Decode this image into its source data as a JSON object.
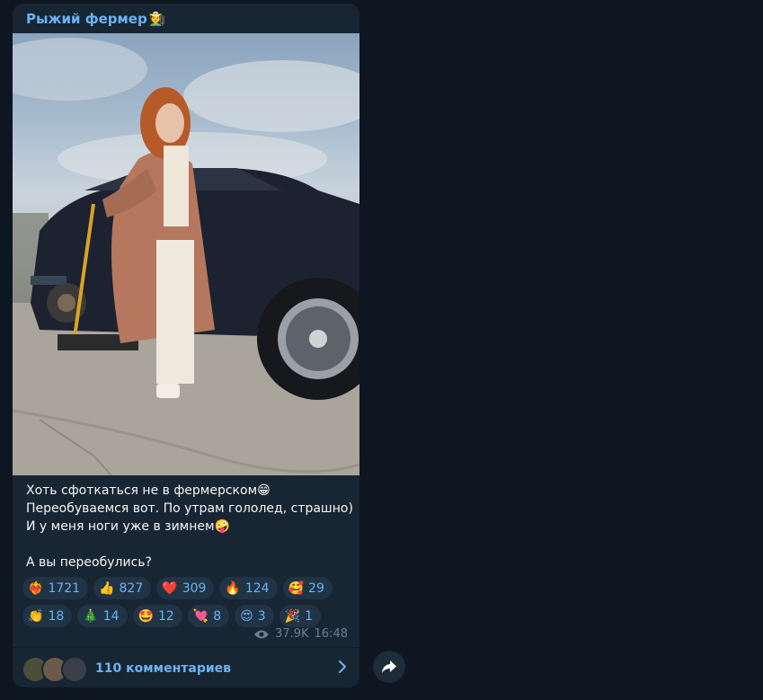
{
  "post": {
    "channel_name": "Рыжий фермер",
    "channel_emoji": "🧑‍🌾",
    "text_lines": [
      {
        "text": "Хоть сфоткаться не в фермерском",
        "emoji": "😁"
      },
      {
        "text": "Переобуваемся вот. По утрам гололед, страшно)",
        "emoji": ""
      },
      {
        "text": "И у меня ноги уже в зимнем",
        "emoji": "🤪"
      },
      {
        "text": "",
        "emoji": ""
      },
      {
        "text": "А вы переобулись?",
        "emoji": ""
      }
    ],
    "reactions_row1": [
      {
        "emoji": "❤️‍🔥",
        "count": "1721"
      },
      {
        "emoji": "👍",
        "count": "827"
      },
      {
        "emoji": "❤️",
        "count": "309"
      },
      {
        "emoji": "🔥",
        "count": "124"
      },
      {
        "emoji": "🥰",
        "count": "29"
      }
    ],
    "reactions_row2": [
      {
        "emoji": "👏",
        "count": "18"
      },
      {
        "emoji": "🎄",
        "count": "14"
      },
      {
        "emoji": "🤩",
        "count": "12"
      },
      {
        "emoji": "💘",
        "count": "8"
      },
      {
        "emoji": "😍",
        "count": "3"
      },
      {
        "emoji": "🎉",
        "count": "1"
      }
    ],
    "views": "37.9K",
    "time": "16:48",
    "comments_label": "110 комментариев"
  },
  "icons": {
    "views": "eye-icon",
    "comments_arrow": "chevron-right-icon",
    "share": "share-arrow-icon"
  },
  "colors": {
    "background": "#0e1621",
    "bubble": "#182533",
    "accent": "#6ab3f3",
    "reaction_bg": "#203446",
    "meta": "#6d7f8f"
  }
}
